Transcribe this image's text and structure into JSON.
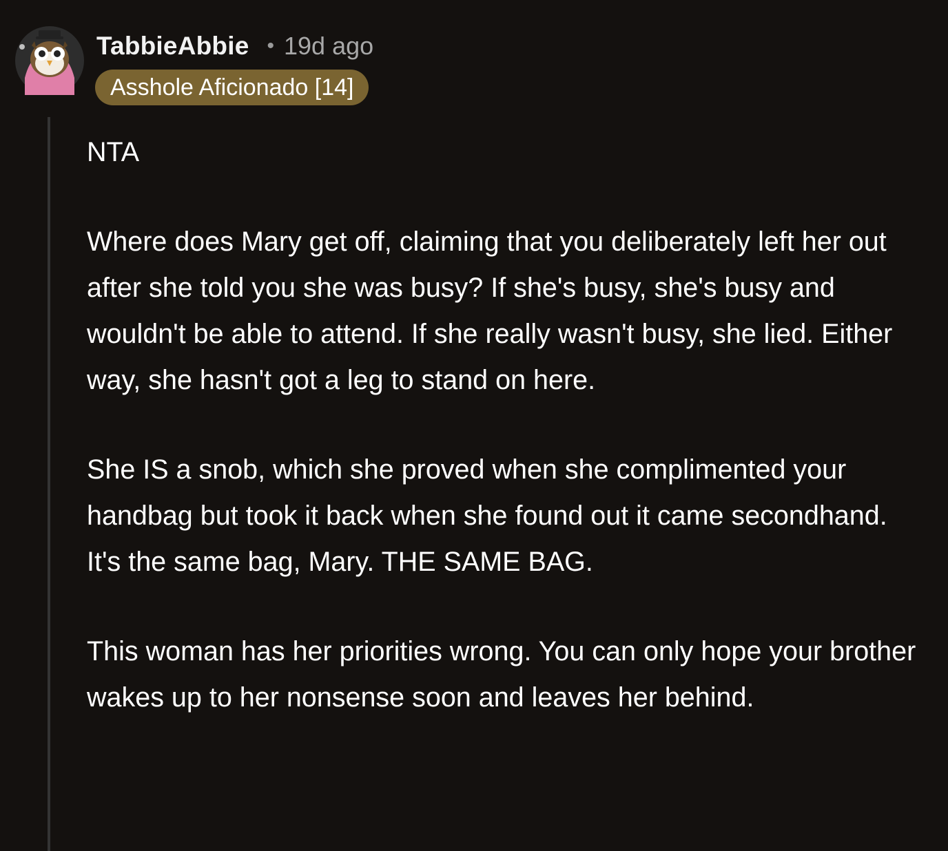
{
  "comment": {
    "author": "TabbieAbbie",
    "separator": "•",
    "timestamp": "19d ago",
    "flair": "Asshole Aficionado [14]",
    "avatar_icon": "owl-avatar-icon",
    "paragraphs": [
      "NTA",
      "Where does Mary get off, claiming that you deliberately left her out after she told you she was busy? If she's busy, she's busy and wouldn't be able to attend. If she really wasn't busy, she lied. Either way, she hasn't got a leg to stand on here.",
      "She IS a snob, which she proved when she complimented your handbag but took it back when she found out it came secondhand. It's the same bag, Mary. THE SAME BAG.",
      "This woman has her priorities wrong. You can only hope your brother wakes up to her nonsense soon and leaves her behind."
    ]
  },
  "colors": {
    "background": "#14110f",
    "flair_bg": "#7a6431",
    "thread_line": "#343434",
    "meta_text": "#a8a8a8"
  }
}
